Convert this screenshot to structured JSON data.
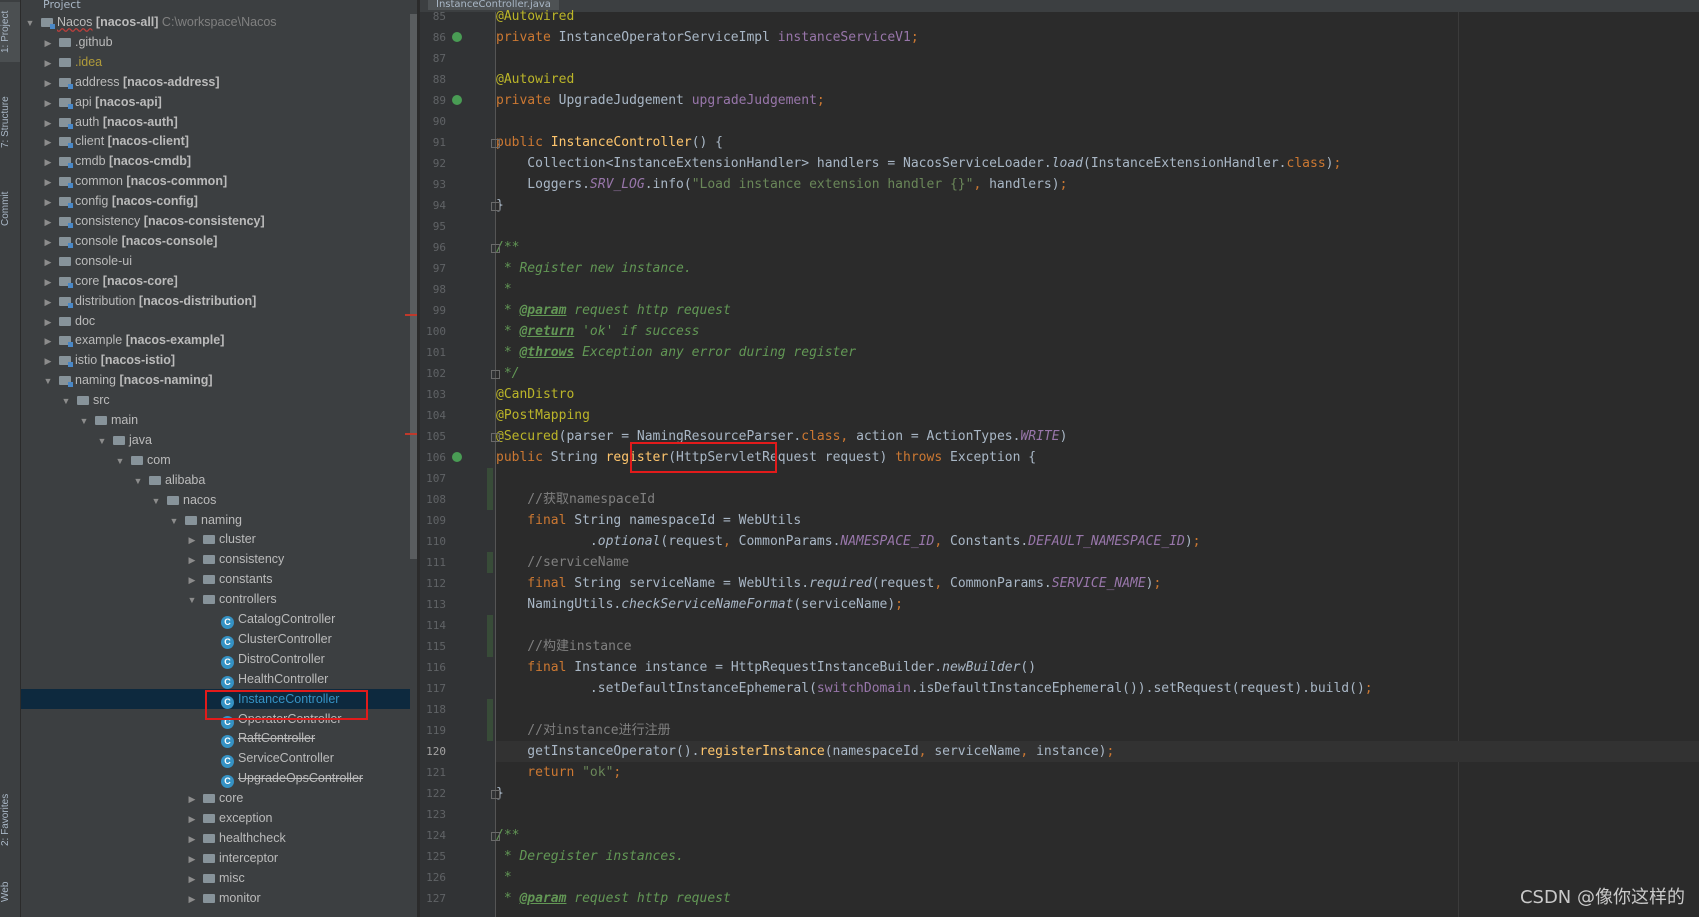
{
  "side_tabs": {
    "project": "1: Project",
    "structure": "7: Structure",
    "commit": "Commit",
    "favorites": "2: Favorites",
    "web": "Web"
  },
  "project_header": "Project",
  "editor_tab": "InstanceController.java",
  "tree": [
    {
      "indent": 0,
      "arrow": "down",
      "icon": "module",
      "name": "Nacos",
      "module": "[nacos-all]",
      "extra": "C:\\workspace\\Nacos",
      "bold": true
    },
    {
      "indent": 1,
      "arrow": "right",
      "icon": "folder",
      "name": ".github"
    },
    {
      "indent": 1,
      "arrow": "right",
      "icon": "folder",
      "name": ".idea",
      "gold": true
    },
    {
      "indent": 1,
      "arrow": "right",
      "icon": "module",
      "name": "address",
      "module": "[nacos-address]"
    },
    {
      "indent": 1,
      "arrow": "right",
      "icon": "module",
      "name": "api",
      "module": "[nacos-api]"
    },
    {
      "indent": 1,
      "arrow": "right",
      "icon": "module",
      "name": "auth",
      "module": "[nacos-auth]"
    },
    {
      "indent": 1,
      "arrow": "right",
      "icon": "module",
      "name": "client",
      "module": "[nacos-client]"
    },
    {
      "indent": 1,
      "arrow": "right",
      "icon": "module",
      "name": "cmdb",
      "module": "[nacos-cmdb]"
    },
    {
      "indent": 1,
      "arrow": "right",
      "icon": "module",
      "name": "common",
      "module": "[nacos-common]"
    },
    {
      "indent": 1,
      "arrow": "right",
      "icon": "module",
      "name": "config",
      "module": "[nacos-config]"
    },
    {
      "indent": 1,
      "arrow": "right",
      "icon": "module",
      "name": "consistency",
      "module": "[nacos-consistency]"
    },
    {
      "indent": 1,
      "arrow": "right",
      "icon": "module",
      "name": "console",
      "module": "[nacos-console]"
    },
    {
      "indent": 1,
      "arrow": "right",
      "icon": "folder",
      "name": "console-ui"
    },
    {
      "indent": 1,
      "arrow": "right",
      "icon": "module",
      "name": "core",
      "module": "[nacos-core]"
    },
    {
      "indent": 1,
      "arrow": "right",
      "icon": "module",
      "name": "distribution",
      "module": "[nacos-distribution]"
    },
    {
      "indent": 1,
      "arrow": "right",
      "icon": "folder",
      "name": "doc"
    },
    {
      "indent": 1,
      "arrow": "right",
      "icon": "module",
      "name": "example",
      "module": "[nacos-example]"
    },
    {
      "indent": 1,
      "arrow": "right",
      "icon": "module",
      "name": "istio",
      "module": "[nacos-istio]"
    },
    {
      "indent": 1,
      "arrow": "down",
      "icon": "module",
      "name": "naming",
      "module": "[nacos-naming]"
    },
    {
      "indent": 2,
      "arrow": "down",
      "icon": "folder",
      "name": "src"
    },
    {
      "indent": 3,
      "arrow": "down",
      "icon": "folder",
      "name": "main"
    },
    {
      "indent": 4,
      "arrow": "down",
      "icon": "folder",
      "name": "java"
    },
    {
      "indent": 5,
      "arrow": "down",
      "icon": "folder",
      "name": "com"
    },
    {
      "indent": 6,
      "arrow": "down",
      "icon": "folder",
      "name": "alibaba"
    },
    {
      "indent": 7,
      "arrow": "down",
      "icon": "folder",
      "name": "nacos"
    },
    {
      "indent": 8,
      "arrow": "down",
      "icon": "folder",
      "name": "naming"
    },
    {
      "indent": 9,
      "arrow": "right",
      "icon": "folder",
      "name": "cluster"
    },
    {
      "indent": 9,
      "arrow": "right",
      "icon": "folder",
      "name": "consistency"
    },
    {
      "indent": 9,
      "arrow": "right",
      "icon": "folder",
      "name": "constants"
    },
    {
      "indent": 9,
      "arrow": "down",
      "icon": "folder",
      "name": "controllers"
    },
    {
      "indent": 10,
      "arrow": "none",
      "icon": "class",
      "name": "CatalogController"
    },
    {
      "indent": 10,
      "arrow": "none",
      "icon": "class",
      "name": "ClusterController"
    },
    {
      "indent": 10,
      "arrow": "none",
      "icon": "class",
      "name": "DistroController"
    },
    {
      "indent": 10,
      "arrow": "none",
      "icon": "class",
      "name": "HealthController"
    },
    {
      "indent": 10,
      "arrow": "none",
      "icon": "class",
      "name": "InstanceController",
      "selected": true
    },
    {
      "indent": 10,
      "arrow": "none",
      "icon": "class",
      "name": "OperatorController"
    },
    {
      "indent": 10,
      "arrow": "none",
      "icon": "class",
      "name": "RaftController",
      "strike": true
    },
    {
      "indent": 10,
      "arrow": "none",
      "icon": "class",
      "name": "ServiceController"
    },
    {
      "indent": 10,
      "arrow": "none",
      "icon": "class",
      "name": "UpgradeOpsController",
      "strike": true
    },
    {
      "indent": 9,
      "arrow": "right",
      "icon": "folder",
      "name": "core"
    },
    {
      "indent": 9,
      "arrow": "right",
      "icon": "folder",
      "name": "exception"
    },
    {
      "indent": 9,
      "arrow": "right",
      "icon": "folder",
      "name": "healthcheck"
    },
    {
      "indent": 9,
      "arrow": "right",
      "icon": "folder",
      "name": "interceptor"
    },
    {
      "indent": 9,
      "arrow": "right",
      "icon": "folder",
      "name": "misc"
    },
    {
      "indent": 9,
      "arrow": "right",
      "icon": "folder",
      "name": "monitor"
    }
  ],
  "code": [
    {
      "n": "85",
      "segs": [
        [
          "an",
          "@Autowired"
        ]
      ]
    },
    {
      "n": "86",
      "segs": [
        [
          "kw",
          "private "
        ],
        [
          "",
          "InstanceOperatorServiceImpl "
        ],
        [
          "fld",
          "instanceServiceV1"
        ],
        [
          "kw",
          ";"
        ]
      ]
    },
    {
      "n": "87",
      "segs": []
    },
    {
      "n": "88",
      "segs": [
        [
          "an",
          "@Autowired"
        ]
      ]
    },
    {
      "n": "89",
      "segs": [
        [
          "kw",
          "private "
        ],
        [
          "",
          "UpgradeJudgement "
        ],
        [
          "fld",
          "upgradeJudgement"
        ],
        [
          "kw",
          ";"
        ]
      ]
    },
    {
      "n": "90",
      "segs": []
    },
    {
      "n": "91",
      "segs": [
        [
          "kw",
          "public "
        ],
        [
          "fn",
          "InstanceController"
        ],
        [
          "",
          "() {"
        ]
      ]
    },
    {
      "n": "92",
      "segs": [
        [
          "",
          "    Collection<InstanceExtensionHandler> handlers = NacosServiceLoader."
        ],
        [
          "it",
          "load"
        ],
        [
          "",
          "(InstanceExtensionHandler."
        ],
        [
          "kw",
          "class"
        ],
        [
          "",
          ")"
        ],
        [
          "kw",
          ";"
        ]
      ]
    },
    {
      "n": "93",
      "segs": [
        [
          "",
          "    Loggers."
        ],
        [
          "st",
          "SRV_LOG"
        ],
        [
          "",
          ".info("
        ],
        [
          "str",
          "\"Load instance extension handler {}\""
        ],
        [
          "kw",
          ", "
        ],
        [
          "",
          "handlers)"
        ],
        [
          "kw",
          ";"
        ]
      ]
    },
    {
      "n": "94",
      "segs": [
        [
          "",
          "}"
        ]
      ]
    },
    {
      "n": "95",
      "segs": []
    },
    {
      "n": "96",
      "segs": [
        [
          "doc",
          "/**"
        ]
      ]
    },
    {
      "n": "97",
      "segs": [
        [
          "doc",
          " * Register new instance."
        ]
      ]
    },
    {
      "n": "98",
      "segs": [
        [
          "doc",
          " *"
        ]
      ]
    },
    {
      "n": "99",
      "segs": [
        [
          "doc",
          " * "
        ],
        [
          "doctag",
          "@param"
        ],
        [
          "doc",
          " request http request"
        ]
      ]
    },
    {
      "n": "100",
      "segs": [
        [
          "doc",
          " * "
        ],
        [
          "doctag",
          "@return"
        ],
        [
          "doc",
          " 'ok' if success"
        ]
      ]
    },
    {
      "n": "101",
      "segs": [
        [
          "doc",
          " * "
        ],
        [
          "doctag",
          "@throws"
        ],
        [
          "doc",
          " Exception any error during register"
        ]
      ]
    },
    {
      "n": "102",
      "segs": [
        [
          "doc",
          " */"
        ]
      ]
    },
    {
      "n": "103",
      "segs": [
        [
          "an",
          "@CanDistro"
        ]
      ]
    },
    {
      "n": "104",
      "segs": [
        [
          "an",
          "@PostMapping"
        ]
      ]
    },
    {
      "n": "105",
      "segs": [
        [
          "an",
          "@Secured"
        ],
        [
          "",
          "(parser = NamingResourceParser."
        ],
        [
          "kw",
          "class, "
        ],
        [
          "",
          "action = ActionTypes."
        ],
        [
          "st",
          "WRITE"
        ],
        [
          "",
          ")"
        ]
      ]
    },
    {
      "n": "106",
      "segs": [
        [
          "kw",
          "public "
        ],
        [
          "",
          "String "
        ],
        [
          "fn",
          "register"
        ],
        [
          "",
          "(HttpServletRequest request) "
        ],
        [
          "kw",
          "throws "
        ],
        [
          "",
          "Exception {"
        ]
      ]
    },
    {
      "n": "107",
      "segs": []
    },
    {
      "n": "108",
      "segs": [
        [
          "cm",
          "    //获取namespaceId"
        ]
      ]
    },
    {
      "n": "109",
      "segs": [
        [
          "kw",
          "    final "
        ],
        [
          "",
          "String namespaceId = WebUtils"
        ]
      ]
    },
    {
      "n": "110",
      "segs": [
        [
          "",
          "            ."
        ],
        [
          "it",
          "optional"
        ],
        [
          "",
          "(request"
        ],
        [
          "kw",
          ", "
        ],
        [
          "",
          "CommonParams."
        ],
        [
          "st",
          "NAMESPACE_ID"
        ],
        [
          "kw",
          ", "
        ],
        [
          "",
          "Constants."
        ],
        [
          "st",
          "DEFAULT_NAMESPACE_ID"
        ],
        [
          "",
          ")"
        ],
        [
          "kw",
          ";"
        ]
      ]
    },
    {
      "n": "111",
      "segs": [
        [
          "cm",
          "    //serviceName"
        ]
      ]
    },
    {
      "n": "112",
      "segs": [
        [
          "kw",
          "    final "
        ],
        [
          "",
          "String serviceName = WebUtils."
        ],
        [
          "it",
          "required"
        ],
        [
          "",
          "(request"
        ],
        [
          "kw",
          ", "
        ],
        [
          "",
          "CommonParams."
        ],
        [
          "st",
          "SERVICE_NAME"
        ],
        [
          "",
          ")"
        ],
        [
          "kw",
          ";"
        ]
      ]
    },
    {
      "n": "113",
      "segs": [
        [
          "",
          "    NamingUtils."
        ],
        [
          "it",
          "checkServiceNameFormat"
        ],
        [
          "",
          "(serviceName)"
        ],
        [
          "kw",
          ";"
        ]
      ]
    },
    {
      "n": "114",
      "segs": []
    },
    {
      "n": "115",
      "segs": [
        [
          "cm",
          "    //构建instance"
        ]
      ]
    },
    {
      "n": "116",
      "segs": [
        [
          "kw",
          "    final "
        ],
        [
          "",
          "Instance instance = HttpRequestInstanceBuilder."
        ],
        [
          "it",
          "newBuilder"
        ],
        [
          "",
          "()"
        ]
      ]
    },
    {
      "n": "117",
      "segs": [
        [
          "",
          "            .setDefaultInstanceEphemeral("
        ],
        [
          "fld",
          "switchDomain"
        ],
        [
          "",
          ".isDefaultInstanceEphemeral()).setRequest(request).build()"
        ],
        [
          "kw",
          ";"
        ]
      ]
    },
    {
      "n": "118",
      "segs": []
    },
    {
      "n": "119",
      "segs": [
        [
          "cm",
          "    //对instance进行注册"
        ]
      ]
    },
    {
      "n": "120",
      "segs": [
        [
          "",
          "    getInstanceOperator()."
        ],
        [
          "fn",
          "registerInstance"
        ],
        [
          "",
          "(namespaceId"
        ],
        [
          "kw",
          ", "
        ],
        [
          "",
          "serviceName"
        ],
        [
          "kw",
          ", "
        ],
        [
          "",
          "instance)"
        ],
        [
          "kw",
          ";"
        ]
      ],
      "current": true
    },
    {
      "n": "121",
      "segs": [
        [
          "kw",
          "    return "
        ],
        [
          "str",
          "\"ok\""
        ],
        [
          "kw",
          ";"
        ]
      ]
    },
    {
      "n": "122",
      "segs": [
        [
          "",
          "}"
        ]
      ]
    },
    {
      "n": "123",
      "segs": []
    },
    {
      "n": "124",
      "segs": [
        [
          "doc",
          "/**"
        ]
      ]
    },
    {
      "n": "125",
      "segs": [
        [
          "doc",
          " * Deregister instances."
        ]
      ]
    },
    {
      "n": "126",
      "segs": [
        [
          "doc",
          " *"
        ]
      ]
    },
    {
      "n": "127",
      "segs": [
        [
          "doc",
          " * "
        ],
        [
          "doctag",
          "@param"
        ],
        [
          "doc",
          " request http request"
        ]
      ]
    }
  ],
  "watermark": "CSDN @像你这样的",
  "colors": {
    "selection_bg": "#0d293e",
    "highlight_box": "#e21b1b",
    "class_icon": "#3592c4"
  }
}
